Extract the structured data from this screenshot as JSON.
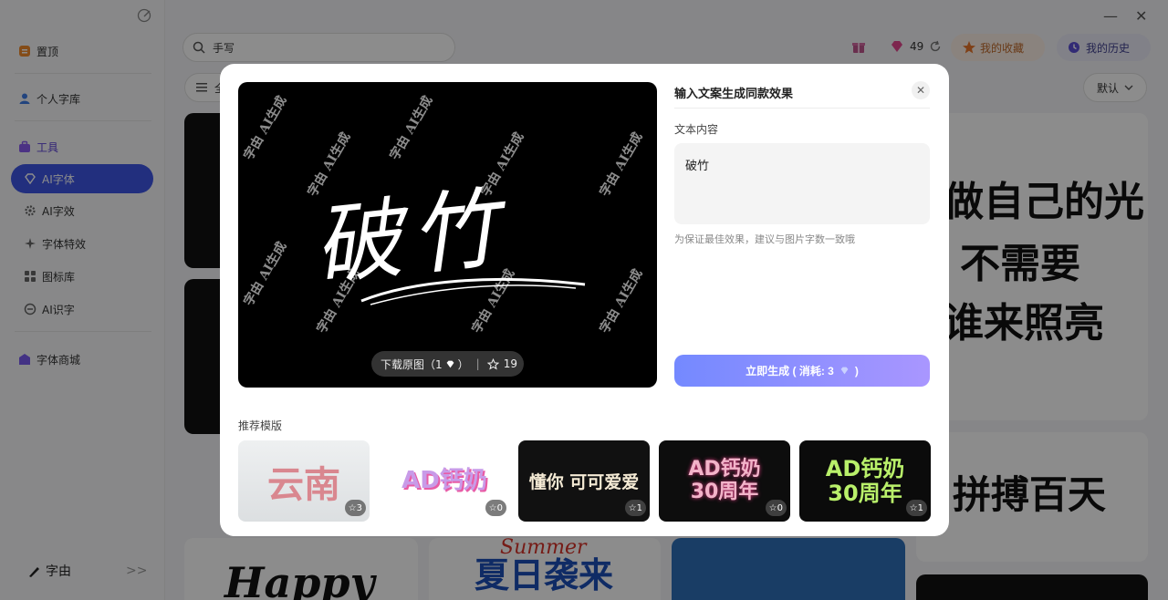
{
  "sidebar": {
    "items": [
      {
        "label": "置顶",
        "icon": "pin-icon"
      },
      {
        "label": "个人字库",
        "icon": "user-icon"
      },
      {
        "label": "工具",
        "icon": "toolbox-icon"
      },
      {
        "label": "AI字体",
        "icon": "diamond-icon"
      },
      {
        "label": "AI字效",
        "icon": "gear-icon"
      },
      {
        "label": "字体特效",
        "icon": "sparkle-icon"
      },
      {
        "label": "图标库",
        "icon": "grid-icon"
      },
      {
        "label": "AI识字",
        "icon": "scan-icon"
      },
      {
        "label": "字体商城",
        "icon": "shop-icon"
      }
    ],
    "logo_text": "字由",
    "collapse_glyph": ">>"
  },
  "header": {
    "search_value": "手写",
    "gem_count": "49",
    "favorites_label": "我的收藏",
    "history_label": "我的历史",
    "minimize": "—",
    "close": "✕"
  },
  "toolbar": {
    "filter_label": "全",
    "sort_label": "默认"
  },
  "cards": {
    "right_top_lines": [
      "做自己的光",
      "不需要",
      "谁来照亮"
    ],
    "right_bottom": "拼搏百天",
    "bottom_left": "Happy",
    "bottom_mid_script": "Summer",
    "bottom_mid": "夏日袭来"
  },
  "modal": {
    "preview_text": "破竹",
    "watermark": "字由 AI生成",
    "download_label": "下载原图（1",
    "download_suffix": "）",
    "fav_count": "19",
    "panel_title": "输入文案生成同款效果",
    "field_label": "文本内容",
    "text_value": "破竹",
    "hint": "为保证最佳效果，建议与图片字数一致哦",
    "generate_label": "立即生成 ( 消耗: 3",
    "generate_suffix": ")",
    "recommend_label": "推荐模版",
    "templates": [
      {
        "text": "云南",
        "count": "3"
      },
      {
        "text": "AD钙奶",
        "count": "0"
      },
      {
        "text": "懂你 可可爱爱",
        "count": "1"
      },
      {
        "text": "AD钙奶30周年",
        "count": "0"
      },
      {
        "text": "AD钙奶30周年",
        "count": "1"
      }
    ]
  },
  "colors": {
    "accent": "#3f57e6",
    "generate_from": "#7489ff",
    "generate_to": "#a996ff"
  }
}
